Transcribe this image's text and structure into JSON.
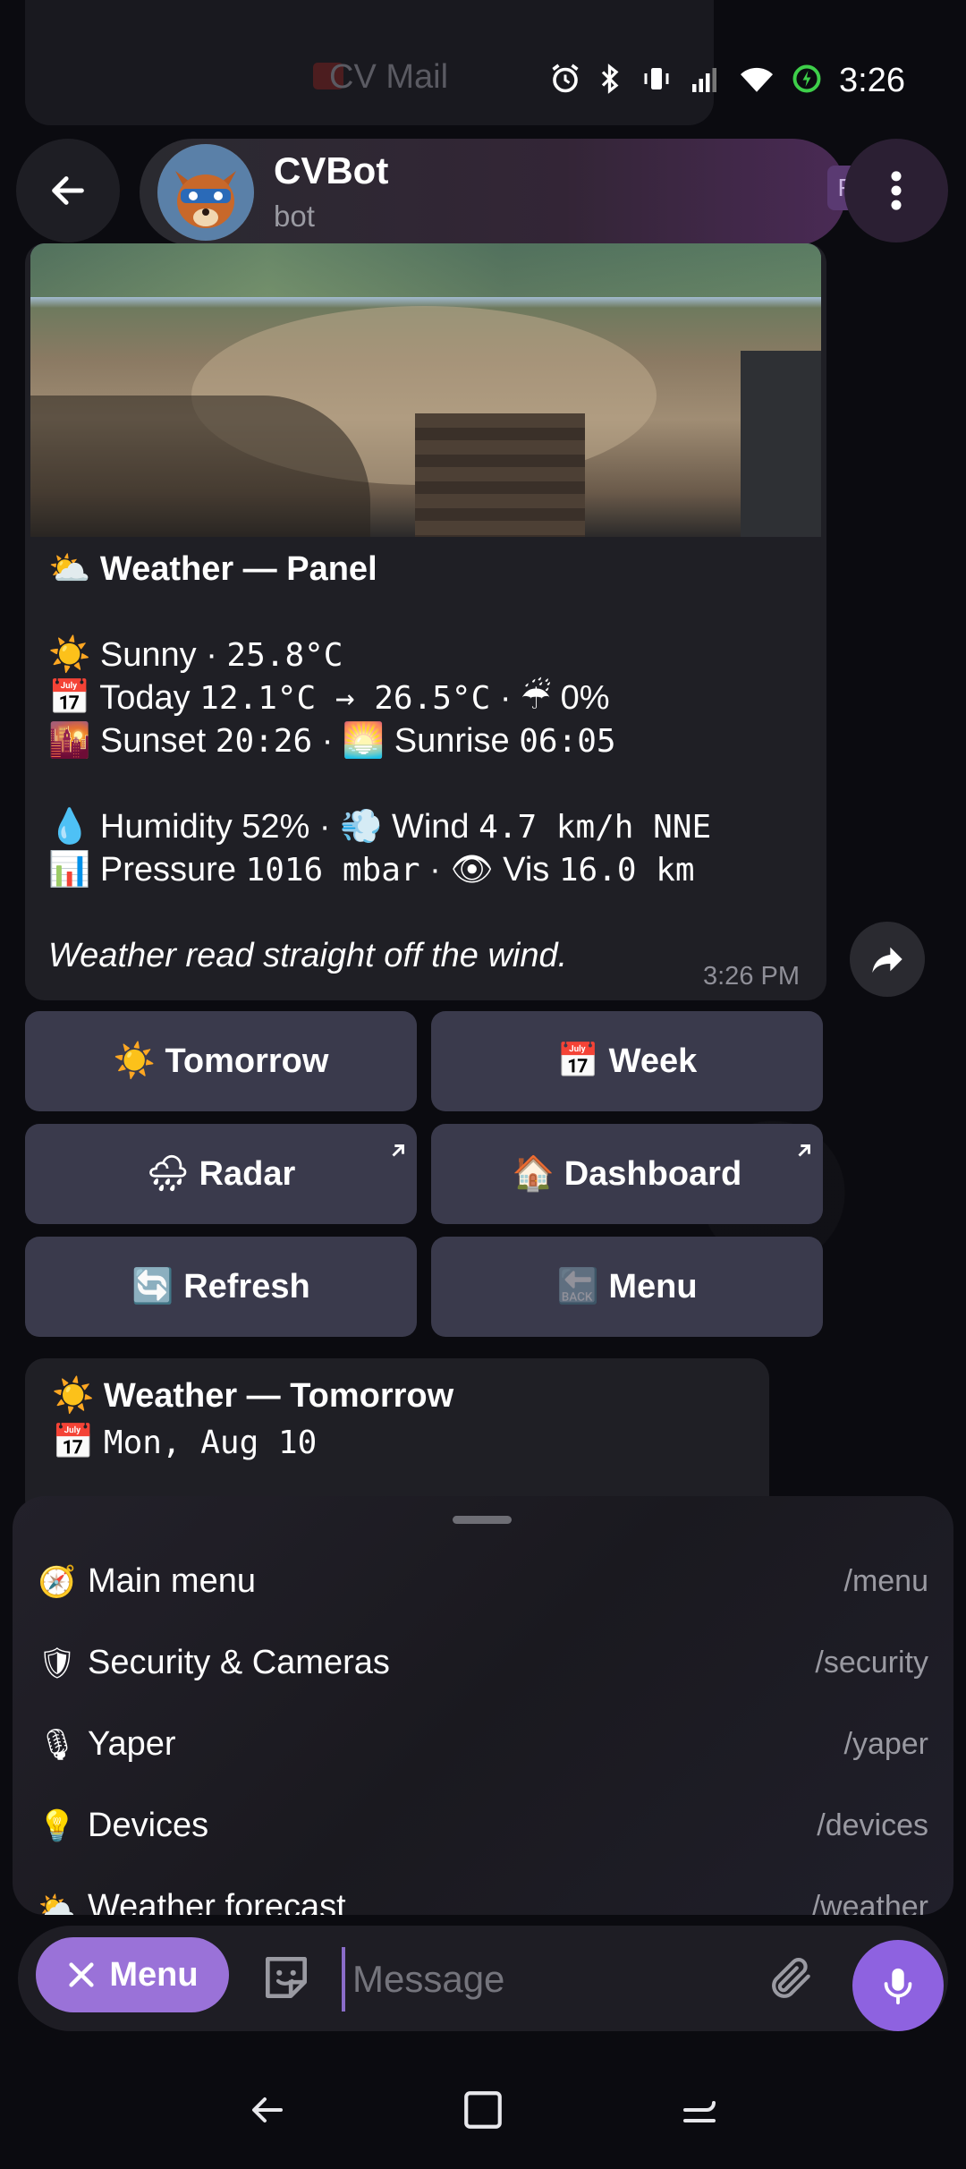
{
  "status_bar": {
    "time": "3:26",
    "ghost_notification": "CV Mail"
  },
  "header": {
    "bot_name": "CVBot",
    "bot_status": "bot",
    "peek_chip": "F"
  },
  "message": {
    "title": "Weather — Panel",
    "title_icon": "⛅",
    "lines": [
      {
        "icon": "☀️",
        "text": "Sunny · ",
        "mono": "25.8°C",
        "after": ""
      },
      {
        "icon": "📅",
        "text": "Today ",
        "mono": "12.1°C → 26.5°C",
        "after": " · ☔ 0%"
      },
      {
        "icon": "🌇",
        "text": "Sunset ",
        "mono": "20:26",
        "after": " · 🌅 Sunrise ",
        "mono2": "06:05"
      }
    ],
    "lines2": [
      {
        "icon": "💧",
        "text": "Humidity 52% · 💨 Wind ",
        "mono": "4.7 km/h NNE"
      },
      {
        "icon": "📊",
        "text": "Pressure ",
        "mono": "1016 mbar",
        "after": " · 👁 Vis ",
        "mono2": "16.0 km"
      }
    ],
    "footer": "Weather read straight off the wind.",
    "time": "3:26 PM"
  },
  "keyboard": [
    {
      "icon": "☀️",
      "label": "Tomorrow",
      "external": false
    },
    {
      "icon": "📅",
      "label": "Week",
      "external": false
    },
    {
      "icon": "🌧",
      "label": "Radar",
      "external": true
    },
    {
      "icon": "🏠",
      "label": "Dashboard",
      "external": true
    },
    {
      "icon": "🔄",
      "label": "Refresh",
      "external": false
    },
    {
      "icon": "🔙",
      "label": "Menu",
      "external": false
    }
  ],
  "message2": {
    "title_icon": "☀️",
    "title": "Weather — Tomorrow",
    "line_icon": "📅",
    "line_mono": "Mon, Aug 10"
  },
  "commands": [
    {
      "icon": "🧭",
      "label": "Main menu",
      "command": "/menu"
    },
    {
      "icon": "🛡",
      "label": "Security & Cameras",
      "command": "/security"
    },
    {
      "icon": "🎙",
      "label": "Yaper",
      "command": "/yaper"
    },
    {
      "icon": "💡",
      "label": "Devices",
      "command": "/devices"
    },
    {
      "icon": "⛅",
      "label": "Weather forecast",
      "command": "/weather"
    }
  ],
  "input": {
    "menu_label": "Menu",
    "placeholder": "Message"
  },
  "colors": {
    "accent": "#9a72d8",
    "mic": "#8e62e0",
    "button_bg": "#3a3a4c",
    "bubble_bg": "#1f1f25"
  }
}
